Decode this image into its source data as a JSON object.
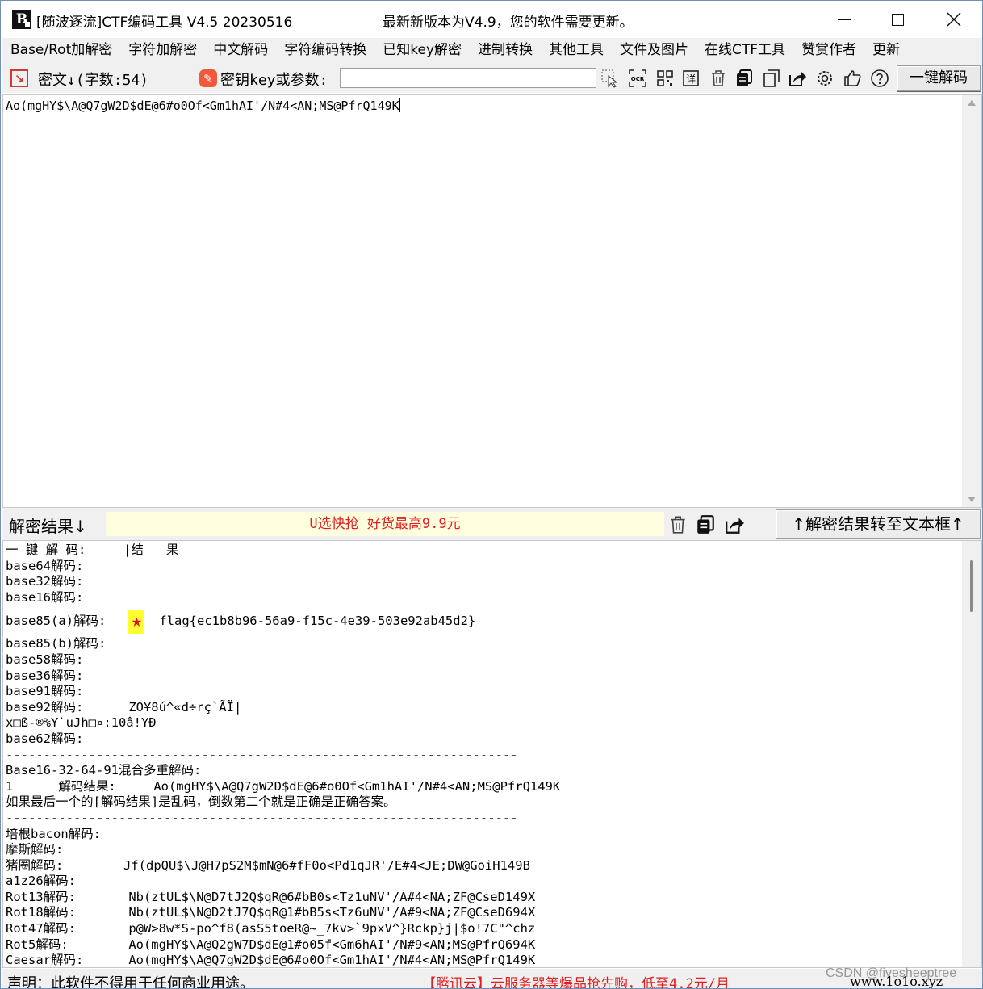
{
  "window": {
    "title": "[随波逐流]CTF编码工具 V4.5 20230516",
    "update_notice": "最新新版本为V4.9，您的软件需要更新。",
    "logo_text": "B"
  },
  "menu": [
    {
      "label": "Base/Rot加解密"
    },
    {
      "label": "字符加解密"
    },
    {
      "label": "中文解码"
    },
    {
      "label": "字符编码转换"
    },
    {
      "label": "已知key解密"
    },
    {
      "label": "进制转换"
    },
    {
      "label": "其他工具"
    },
    {
      "label": "文件及图片"
    },
    {
      "label": "在线CTF工具"
    },
    {
      "label": "赞赏作者"
    },
    {
      "label": "更新"
    }
  ],
  "toolbar": {
    "cipher_label": "密文↓(字数:54)",
    "key_label": "密钥key或参数:",
    "key_value": "",
    "onekey_button": "一键解码",
    "icons": [
      "cursor-select-icon",
      "ocr-icon",
      "qr-code-icon",
      "detail-icon",
      "trash-icon",
      "copy-icon",
      "paste-icon",
      "share-icon",
      "settings-icon",
      "thumbs-up-icon",
      "help-icon"
    ],
    "ocr_text": "OCR",
    "detail_text": "详"
  },
  "input": {
    "text": "Ao(mgHY$\\A@Q7gW2D$dE@6#o0Of<Gm1hAI'/N#4<AN;MS@PfrQ149K"
  },
  "result": {
    "label": "解密结果↓",
    "ad_text": "U选快抢 好货最高9.9元",
    "to_textbox_button": "↑解密结果转至文本框↑"
  },
  "output": {
    "lines": [
      "一 键 解 码:     |结   果",
      "base64解码:",
      "base32解码:",
      "base16解码:",
      "__STAR__",
      "base85(b)解码:",
      "base58解码:",
      "base36解码:",
      "base91解码:",
      "base92解码:      ZO¥8ú^«d÷rç`ÃÏ|",
      "x□ß-®%Y`uJh□¤:10â!YÐ",
      "base62解码:",
      "--------------------------------------------------------------------",
      "Base16-32-64-91混合多重解码:",
      "1      解码结果:     Ao(mgHY$\\A@Q7gW2D$dE@6#o0Of<Gm1hAI'/N#4<AN;MS@PfrQ149K",
      "如果最后一个的[解码结果]是乱码，倒数第二个就是正确是正确答案。",
      "--------------------------------------------------------------------",
      "培根bacon解码:",
      "摩斯解码:",
      "猪圈解码:        Jf(dpQU$\\J@H7pS2M$mN@6#fF0o<Pd1qJR'/E#4<JE;DW@GoiH149B",
      "a1z26解码:",
      "Rot13解码:       Nb(ztUL$\\N@D7tJ2Q$qR@6#bB0s<Tz1uNV'/A#4<NA;ZF@CseD149X",
      "Rot18解码:       Nb(ztUL$\\N@D2tJ7Q$qR@1#bB5s<Tz6uNV'/A#9<NA;ZF@CseD694X",
      "Rot47解码:       p@W>8w*S-po^f8(asS5toeR@~_7kv>`9pxV^}Rckp}j|$o!7C\"^chz",
      "Rot5解码:        Ao(mgHY$\\A@Q2gW7D$dE@1#o05f<Gm6hAI'/N#9<AN;MS@PfrQ694K",
      "Caesar解码:      Ao(mgHY$\\A@Q7gW2D$dE@6#o0Of<Gm1hAI'/N#4<AN;MS@PfrQ149K"
    ],
    "base85a_label": "base85(a)解码:",
    "flag": "flag{ec1b8b96-56a9-f15c-4e39-503e92ab45d2}"
  },
  "statusbar": {
    "disclaimer": "声明：此软件不得用于任何商业用途。",
    "ad": "【腾讯云】云服务器等爆品抢先购，低至4.2元/月",
    "url": "www.1o1o.xyz"
  },
  "watermark": "CSDN @fivesheeptree"
}
